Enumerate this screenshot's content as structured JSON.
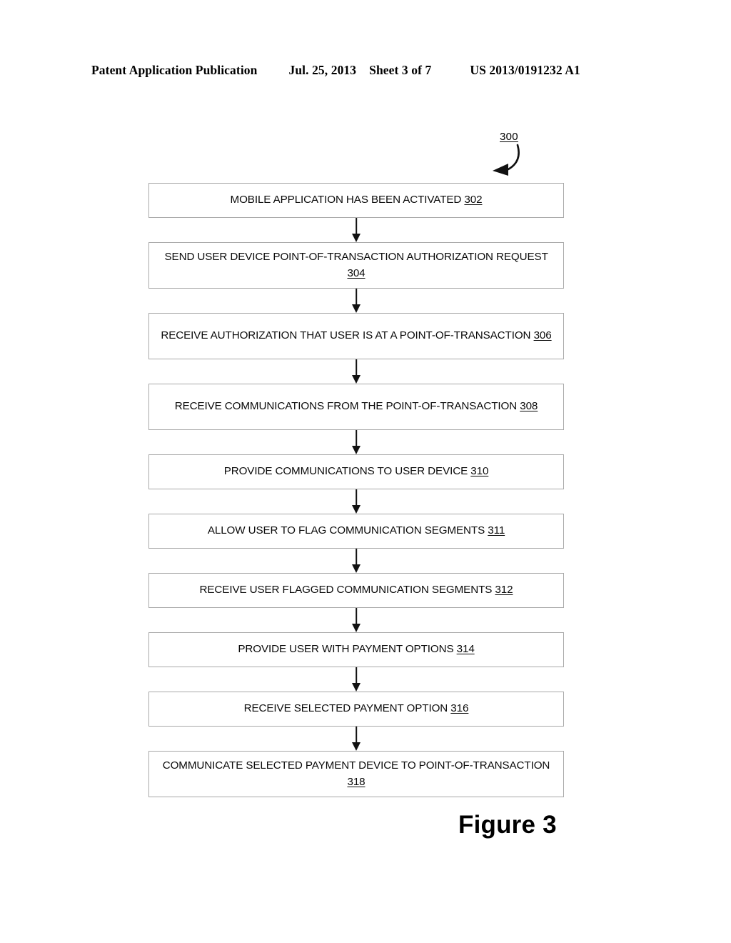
{
  "header": {
    "publication": "Patent Application Publication",
    "date": "Jul. 25, 2013",
    "sheet": "Sheet 3 of 7",
    "patent_number": "US 2013/0191232 A1"
  },
  "figure": {
    "reference_numeral": "300",
    "caption": "Figure 3",
    "pointer_icon": "curved-arrow-icon"
  },
  "flowchart": {
    "type": "flowchart",
    "orientation": "vertical",
    "connector_icon": "down-arrow-icon",
    "nodes": [
      {
        "id": "302",
        "text": "MOBILE APPLICATION HAS BEEN ACTIVATED",
        "numeral": "302",
        "lines": 1
      },
      {
        "id": "304",
        "text": "SEND USER DEVICE POINT-OF-TRANSACTION AUTHORIZATION REQUEST",
        "numeral": "304",
        "lines": 2
      },
      {
        "id": "306",
        "text": "RECEIVE AUTHORIZATION THAT USER IS AT A POINT-OF-TRANSACTION",
        "numeral": "306",
        "lines": 2
      },
      {
        "id": "308",
        "text": "RECEIVE COMMUNICATIONS FROM THE POINT-OF-TRANSACTION",
        "numeral": "308",
        "lines": 2
      },
      {
        "id": "310",
        "text": "PROVIDE COMMUNICATIONS TO USER DEVICE",
        "numeral": "310",
        "lines": 1
      },
      {
        "id": "311",
        "text": "ALLOW USER TO FLAG COMMUNICATION SEGMENTS",
        "numeral": "311",
        "lines": 1
      },
      {
        "id": "312",
        "text": "RECEIVE USER FLAGGED COMMUNICATION SEGMENTS",
        "numeral": "312",
        "lines": 1
      },
      {
        "id": "314",
        "text": "PROVIDE USER WITH PAYMENT OPTIONS",
        "numeral": "314",
        "lines": 1
      },
      {
        "id": "316",
        "text": "RECEIVE SELECTED PAYMENT OPTION",
        "numeral": "316",
        "lines": 1
      },
      {
        "id": "318",
        "text": "COMMUNICATE SELECTED PAYMENT DEVICE TO POINT-OF-TRANSACTION",
        "numeral": "318",
        "lines": 2
      }
    ]
  },
  "colors": {
    "page_background": "#ffffff",
    "text": "#000000",
    "box_border": "#a8a8a8",
    "arrow": "#111111"
  }
}
